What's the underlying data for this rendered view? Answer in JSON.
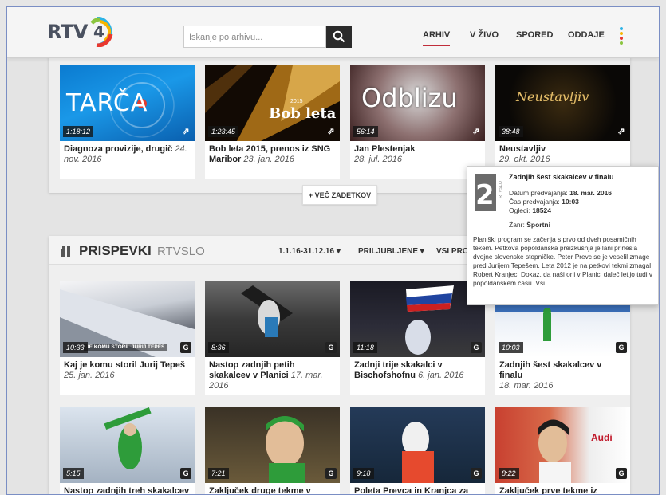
{
  "header": {
    "logo_text": "RTV",
    "logo_number": "4",
    "search_placeholder": "Iskanje po arhivu...",
    "nav": [
      "ARHIV",
      "V ŽIVO",
      "SPORED",
      "ODDAJE"
    ],
    "accent_color": "#c02d3a"
  },
  "archive": {
    "cards": [
      {
        "thumb_text": "TARČA",
        "duration": "1:18:12",
        "title": "Diagnoza provizije, drugič",
        "date": "24. nov. 2016"
      },
      {
        "thumb_text": "Bob leta",
        "thumb_year": "2015",
        "duration": "1:23:45",
        "title": "Bob leta 2015, prenos iz SNG Maribor",
        "date": "23. jan. 2016"
      },
      {
        "thumb_text": "Odblizu",
        "duration": "56:14",
        "title": "Jan Plestenjak",
        "date": "28. jul. 2016"
      },
      {
        "thumb_text": "Neustavljiv",
        "duration": "38:48",
        "title": "Neustavljiv",
        "date": "29. okt. 2016"
      }
    ],
    "more_label": "+ VEČ ZADETKOV"
  },
  "prispevki": {
    "title": "PRISPEVKI",
    "subtitle": "RTVSLO",
    "filters": [
      "1.1.16-31.12.16",
      "PRILJUBLJENE",
      "VSI PRO"
    ],
    "cards": [
      {
        "duration": "10:33",
        "overlay": "JE KOMU STORIL JURIJ TEPEŠ",
        "title": "Kaj je komu storil Jurij Tepeš",
        "date": "25. jan. 2016"
      },
      {
        "duration": "8:36",
        "title": "Nastop zadnjih petih skakalcev v Planici",
        "date": "17. mar. 2016"
      },
      {
        "duration": "11:18",
        "title": "Zadnji trije skakalci v Bischofshofnu",
        "date": "6. jan. 2016"
      },
      {
        "duration": "10:03",
        "title": "Zadnjih šest skakalcev v finalu",
        "date": "18. mar. 2016"
      },
      {
        "duration": "5:15",
        "title": "Nastop zadnjih treh skakalcev",
        "date": ""
      },
      {
        "duration": "7:21",
        "title": "Zaključek druge tekme v",
        "date": ""
      },
      {
        "duration": "9:18",
        "title": "Poleta Prevca in Kranjca za",
        "date": ""
      },
      {
        "duration": "8:22",
        "title": "Zaključek prve tekme iz",
        "date": ""
      }
    ]
  },
  "popup": {
    "title": "Zadnjih šest skakalcev v finalu",
    "broadcast_date_label": "Datum predvajanja:",
    "broadcast_date": "18. mar. 2016",
    "broadcast_time_label": "Čas predvajanja:",
    "broadcast_time": "10:03",
    "views_label": "Ogledi:",
    "views": "18524",
    "genre_label": "Žanr:",
    "genre": "Športni",
    "description": "Planiški program se začenja s prvo od dveh posamičnih tekem. Petkova popoldanska preizkušnja je lani prinesla dvojne slovenske stopničke. Peter Prevc se je veselil zmage pred Jurijem Tepešem. Leta 2012 je na petkovi tekmi zmagal Robert Kranjec. Dokaz, da naši orli v Planici daleč letijo tudi v popoldanskem času. Vsi...",
    "channel_label": "RTVSLO"
  }
}
